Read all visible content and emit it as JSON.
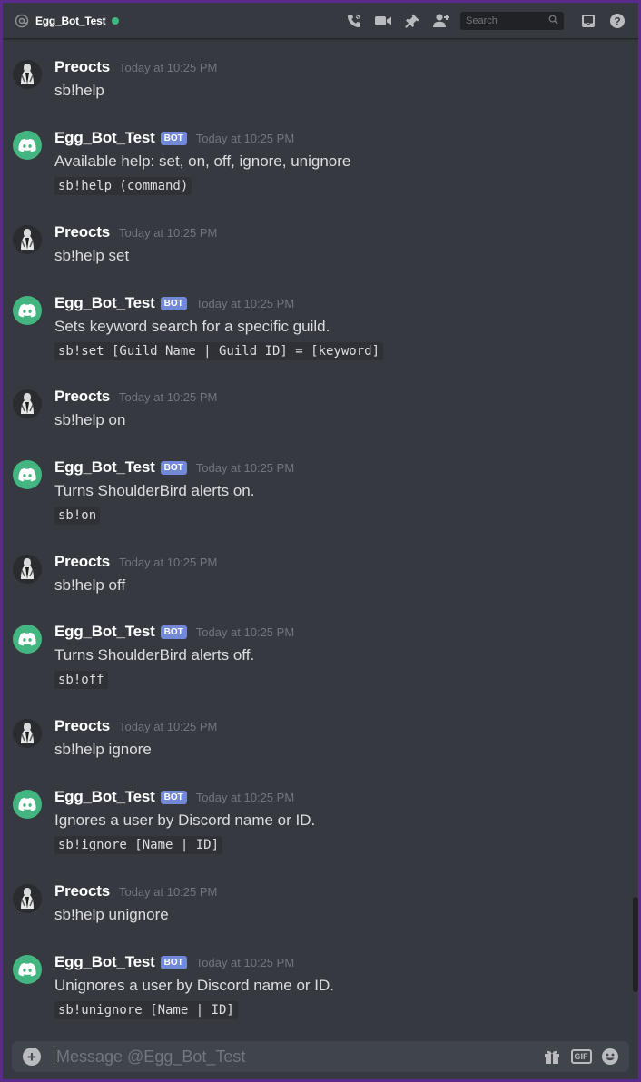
{
  "header": {
    "channel_name": "Egg_Bot_Test",
    "search_placeholder": "Search",
    "icons": [
      "at-icon",
      "call-icon",
      "video-icon",
      "pin-icon",
      "add-member-icon",
      "search-icon",
      "inbox-icon",
      "help-icon"
    ],
    "status_color": "#43b581"
  },
  "messages": [
    {
      "author": "Preocts",
      "bot": false,
      "time": "Today at 10:25 PM",
      "text": "sb!help",
      "code": null
    },
    {
      "author": "Egg_Bot_Test",
      "bot": true,
      "bot_tag": "BOT",
      "time": "Today at 10:25 PM",
      "text": "Available help: set, on, off, ignore, unignore",
      "code": "sb!help (command)"
    },
    {
      "author": "Preocts",
      "bot": false,
      "time": "Today at 10:25 PM",
      "text": "sb!help set",
      "code": null
    },
    {
      "author": "Egg_Bot_Test",
      "bot": true,
      "bot_tag": "BOT",
      "time": "Today at 10:25 PM",
      "text": "Sets keyword search for a specific guild.",
      "code": "sb!set [Guild Name | Guild ID] = [keyword]"
    },
    {
      "author": "Preocts",
      "bot": false,
      "time": "Today at 10:25 PM",
      "text": "sb!help on",
      "code": null
    },
    {
      "author": "Egg_Bot_Test",
      "bot": true,
      "bot_tag": "BOT",
      "time": "Today at 10:25 PM",
      "text": "Turns ShoulderBird alerts on.",
      "code": "sb!on"
    },
    {
      "author": "Preocts",
      "bot": false,
      "time": "Today at 10:25 PM",
      "text": "sb!help off",
      "code": null
    },
    {
      "author": "Egg_Bot_Test",
      "bot": true,
      "bot_tag": "BOT",
      "time": "Today at 10:25 PM",
      "text": "Turns ShoulderBird alerts off.",
      "code": "sb!off"
    },
    {
      "author": "Preocts",
      "bot": false,
      "time": "Today at 10:25 PM",
      "text": "sb!help ignore",
      "code": null
    },
    {
      "author": "Egg_Bot_Test",
      "bot": true,
      "bot_tag": "BOT",
      "time": "Today at 10:25 PM",
      "text": "Ignores a user by Discord name or ID.",
      "code": "sb!ignore [Name | ID]"
    },
    {
      "author": "Preocts",
      "bot": false,
      "time": "Today at 10:25 PM",
      "text": "sb!help unignore",
      "code": null
    },
    {
      "author": "Egg_Bot_Test",
      "bot": true,
      "bot_tag": "BOT",
      "time": "Today at 10:25 PM",
      "text": "Unignores a user by Discord name or ID.",
      "code": "sb!unignore [Name | ID]"
    }
  ],
  "composer": {
    "placeholder": "Message @Egg_Bot_Test",
    "gif_label": "GIF",
    "icons": [
      "attach-plus-icon",
      "gift-icon",
      "gif-icon",
      "emoji-icon"
    ]
  },
  "colors": {
    "frame_border": "#5b2b8c",
    "background": "#36393f",
    "bot_tag": "#7289da",
    "bot_avatar": "#43b581"
  }
}
